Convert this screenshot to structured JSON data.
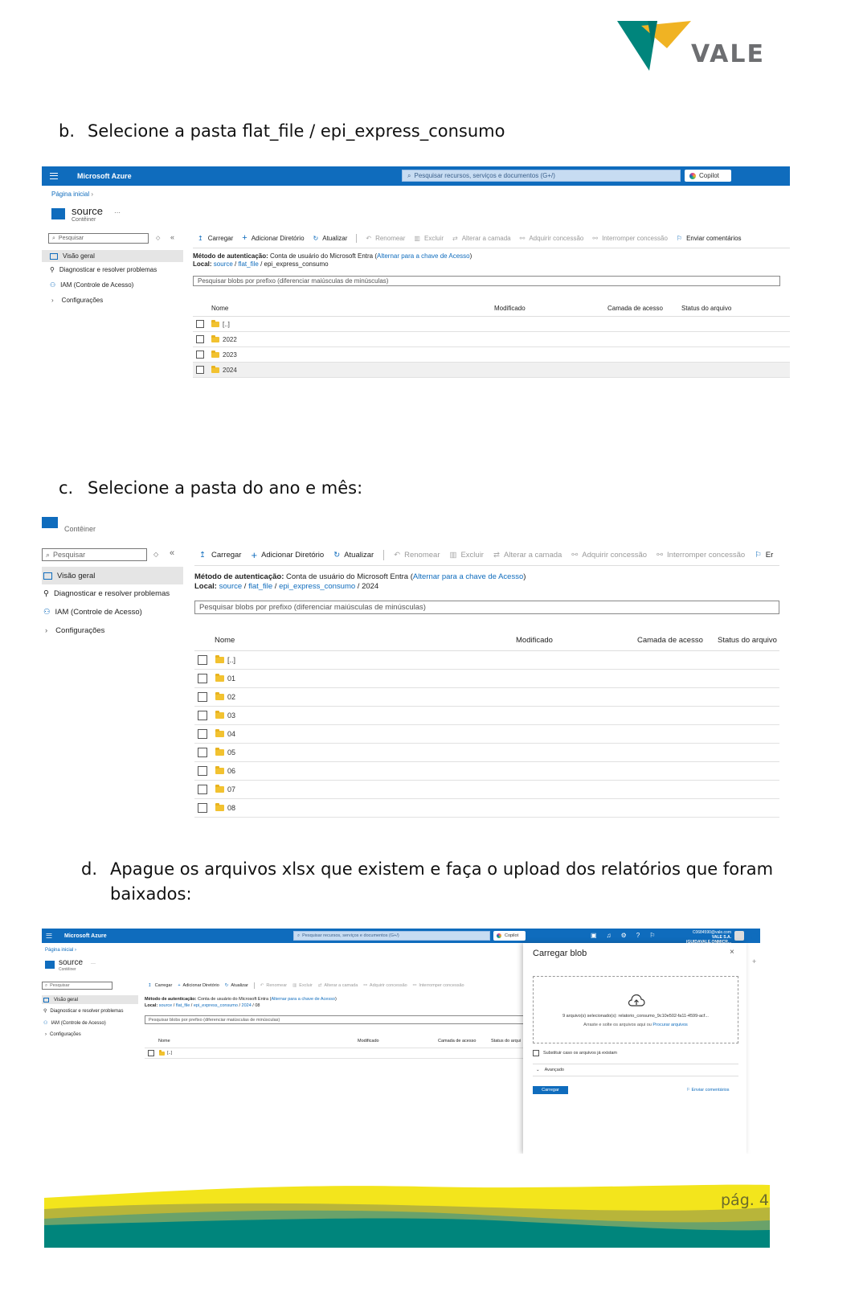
{
  "logo": {
    "text": "VALE"
  },
  "steps": {
    "b": {
      "marker": "b.",
      "text": "Selecione a pasta flat_file / epi_express_consumo"
    },
    "c": {
      "marker": "c.",
      "text": "Selecione a pasta do ano e mês:"
    },
    "d": {
      "marker": "d.",
      "text_line1": "Apague os arquivos xlsx que existem e faça o upload dos relatórios que foram",
      "text_line2": "baixados:"
    }
  },
  "azure": {
    "brand": "Microsoft Azure",
    "search_placeholder": "Pesquisar recursos, serviços e documentos (G+/)",
    "copilot": "Copilot",
    "breadcrumb": "Página inicial",
    "container_name": "source",
    "container_type": "Contêiner",
    "more": "···",
    "side_search": "Pesquisar",
    "side_items": [
      "Visão geral",
      "Diagnosticar e resolver problemas",
      "IAM (Controle de Acesso)",
      "Configurações"
    ],
    "toolbar": {
      "upload": "Carregar",
      "add_dir": "Adicionar Diretório",
      "refresh": "Atualizar",
      "rename": "Renomear",
      "delete": "Excluir",
      "change_tier": "Alterar a camada",
      "acquire_lease": "Adquirir concessão",
      "break_lease": "Interromper concessão",
      "feedback": "Enviar comentários",
      "feedback_cut": "Er"
    },
    "auth_label": "Método de autenticação:",
    "auth_value": "Conta de usuário do Microsoft Entra",
    "auth_link": "Alternar para a chave de Acesso",
    "location_label": "Local:",
    "path": {
      "source": "source",
      "flat_file": "flat_file",
      "epi": "epi_express_consumo",
      "year": "2024",
      "month": "08"
    },
    "filter_placeholder": "Pesquisar blobs por prefixo (diferenciar maiúsculas de minúsculas)",
    "columns": {
      "name": "Nome",
      "modified": "Modificado",
      "tier": "Camada de acesso",
      "status": "Status do arquivo",
      "status_cut": "Status do arqui"
    },
    "shot1_rows": [
      "[..]",
      "2022",
      "2023",
      "2024"
    ],
    "shot2_rows": [
      "[..]",
      "01",
      "02",
      "03",
      "04",
      "05",
      "06",
      "07",
      "08"
    ],
    "shot3_rows": [
      "[..]"
    ],
    "account": {
      "email": "C0684590@vale.com",
      "org": "VALE S.A. (GUIDAVALE.ONMICR..."
    },
    "upload_panel": {
      "title": "Carregar blob",
      "files_selected": "9 arquivo(s) selecionado(s): relatorio_consumo_9c10e502-fa11-4599-acf...",
      "drag_text": "Arraste e solte os arquivos aqui ou",
      "browse": "Procurar arquivos",
      "overwrite": "Substituir caso os arquivos já existam",
      "advanced": "Avançado",
      "upload_button": "Carregar",
      "feedback": "Enviar comentários"
    }
  },
  "footer": {
    "page": "pág. 4"
  },
  "colors": {
    "azure_blue": "#0f6cbd",
    "vale_green": "#00857c",
    "vale_yellow": "#f3d91f"
  }
}
